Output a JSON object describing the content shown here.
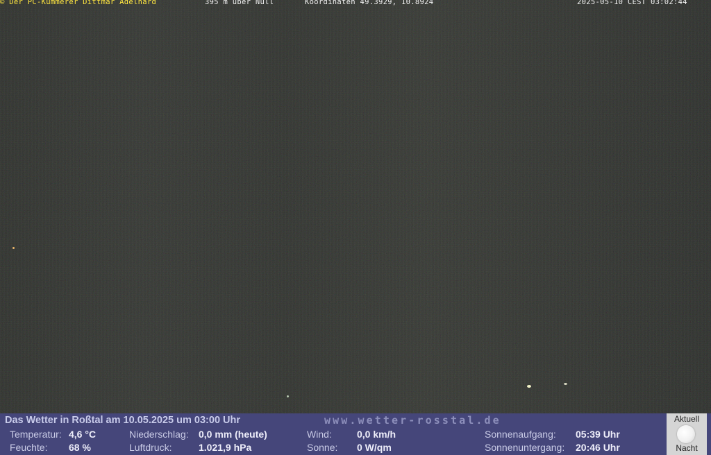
{
  "overlay": {
    "credit": "© Der PC-Kümmerer Dittmar Adelhard",
    "altitude": "395 m über Null",
    "coordinates": "Koordinaten 49.3929, 10.8924",
    "timestamp": "2025-05-10 CEST 03:02:44"
  },
  "weather": {
    "headline": "Das Wetter in Roßtal am 10.05.2025 um 03:00 Uhr",
    "website": "www.wetter-rosstal.de",
    "temperature": {
      "label": "Temperatur:",
      "value": "4,6 °C"
    },
    "humidity": {
      "label": "Feuchte:",
      "value": "68 %"
    },
    "precipitation": {
      "label": "Niederschlag:",
      "value": "0,0 mm (heute)"
    },
    "pressure": {
      "label": "Luftdruck:",
      "value": "1.021,9 hPa"
    },
    "wind": {
      "label": "Wind:",
      "value": "0,0 km/h"
    },
    "sun": {
      "label": "Sonne:",
      "value": "0 W/qm"
    },
    "sunrise": {
      "label": "Sonnenaufgang:",
      "value": "05:39 Uhr"
    },
    "sunset": {
      "label": "Sonnenuntergang:",
      "value": "20:46 Uhr"
    }
  },
  "moon": {
    "status_label": "Aktuell",
    "phase_label": "Nacht",
    "icon": "full-moon-icon"
  }
}
